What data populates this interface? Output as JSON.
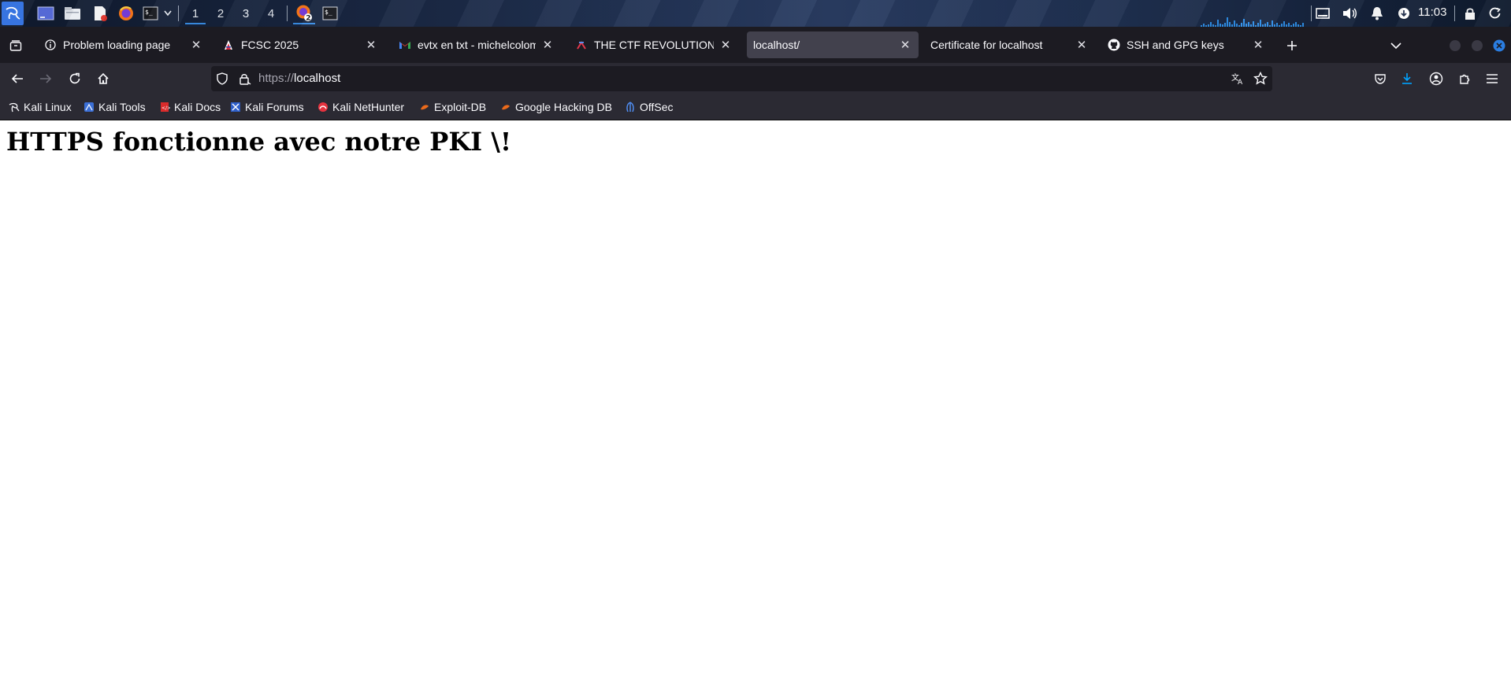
{
  "panel": {
    "workspaces": [
      "1",
      "2",
      "3",
      "4"
    ],
    "active_workspace": "1",
    "firefox_badge": "2",
    "clock": "11:03",
    "icons": [
      "kali-menu-icon",
      "desktop-icon",
      "file-manager-icon",
      "text-editor-icon",
      "firefox-icon",
      "terminal-icon",
      "chevron-down-icon",
      "firefox-task-icon",
      "terminal-task-icon",
      "display-icon",
      "volume-icon",
      "notification-bell-icon",
      "network-icon",
      "lock-icon",
      "power-icon"
    ]
  },
  "tabs": [
    {
      "title": "Problem loading page",
      "favicon": "info-icon",
      "selected": false
    },
    {
      "title": "FCSC 2025",
      "favicon": "fcsc-icon",
      "selected": false
    },
    {
      "title": "evtx en txt - michelcolomb",
      "favicon": "gmail-icon",
      "selected": false
    },
    {
      "title": "THE CTF REVOLUTION",
      "favicon": "ctf-icon",
      "selected": false
    },
    {
      "title": "localhost/",
      "favicon": "",
      "selected": true
    },
    {
      "title": "Certificate for localhost",
      "favicon": "",
      "selected": false
    },
    {
      "title": "SSH and GPG keys",
      "favicon": "github-icon",
      "selected": false
    }
  ],
  "urlbar": {
    "scheme": "https://",
    "host": "localhost"
  },
  "bookmarks": [
    {
      "label": "Kali Linux",
      "icon": "kali-dragon-icon"
    },
    {
      "label": "Kali Tools",
      "icon": "kali-tools-icon"
    },
    {
      "label": "Kali Docs",
      "icon": "kali-docs-icon"
    },
    {
      "label": "Kali Forums",
      "icon": "kali-forums-icon"
    },
    {
      "label": "Kali NetHunter",
      "icon": "nethunter-icon"
    },
    {
      "label": "Exploit-DB",
      "icon": "exploitdb-icon"
    },
    {
      "label": "Google Hacking DB",
      "icon": "ghdb-icon"
    },
    {
      "label": "OffSec",
      "icon": "offsec-icon"
    }
  ],
  "page": {
    "heading": "HTTPS fonctionne avec notre PKI \\!"
  },
  "colors": {
    "firefox_dark": "#1c1b22",
    "toolbar": "#2b2a33",
    "selected_tab": "#42414d",
    "accent_blue": "#0061e0",
    "kali_blue": "#2f6fe0"
  }
}
